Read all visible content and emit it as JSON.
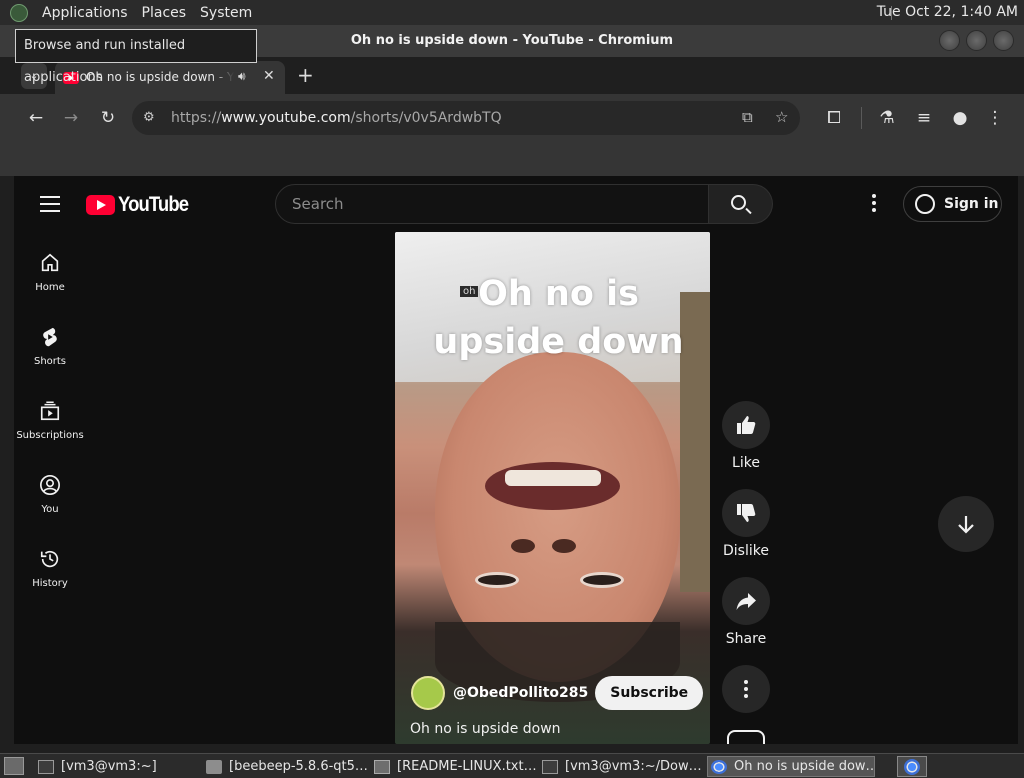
{
  "panel": {
    "menu": [
      "Applications",
      "Places",
      "System"
    ],
    "clock": "Tue Oct 22,  1:40 AM",
    "tooltip": "Browse and run installed applications"
  },
  "window": {
    "title": "Oh no is upside down - YouTube - Chromium"
  },
  "tab": {
    "title": "Oh no is upside down - YouTube",
    "close": "✕",
    "new": "+",
    "menu": "⌄"
  },
  "toolbar": {
    "url_prefix": "https://",
    "url_host": "www.youtube.com",
    "url_path": "/shorts/v0v5ArdwbTQ"
  },
  "youtube": {
    "logo": "YouTube",
    "search_placeholder": "Search",
    "signin": "Sign in",
    "guide": [
      {
        "label": "Home",
        "icon": "home-icon"
      },
      {
        "label": "Shorts",
        "icon": "shorts-icon"
      },
      {
        "label": "Subscriptions",
        "icon": "subscriptions-icon"
      },
      {
        "label": "You",
        "icon": "you-icon"
      },
      {
        "label": "History",
        "icon": "history-icon"
      }
    ],
    "short": {
      "caption_line1": "Oh no is",
      "caption_line2": "upside down",
      "tag": "oh",
      "channel": "@ObedPollito285",
      "subscribe": "Subscribe",
      "description": "Oh no is upside down"
    },
    "actions": {
      "like": "Like",
      "dislike": "Dislike",
      "share": "Share"
    }
  },
  "taskbar": {
    "items": [
      "[vm3@vm3:~]",
      "[beebeep-5.8.6-qt5…",
      "[README-LINUX.txt…",
      "[vm3@vm3:~/Dow…",
      "Oh no is upside dow…"
    ]
  }
}
